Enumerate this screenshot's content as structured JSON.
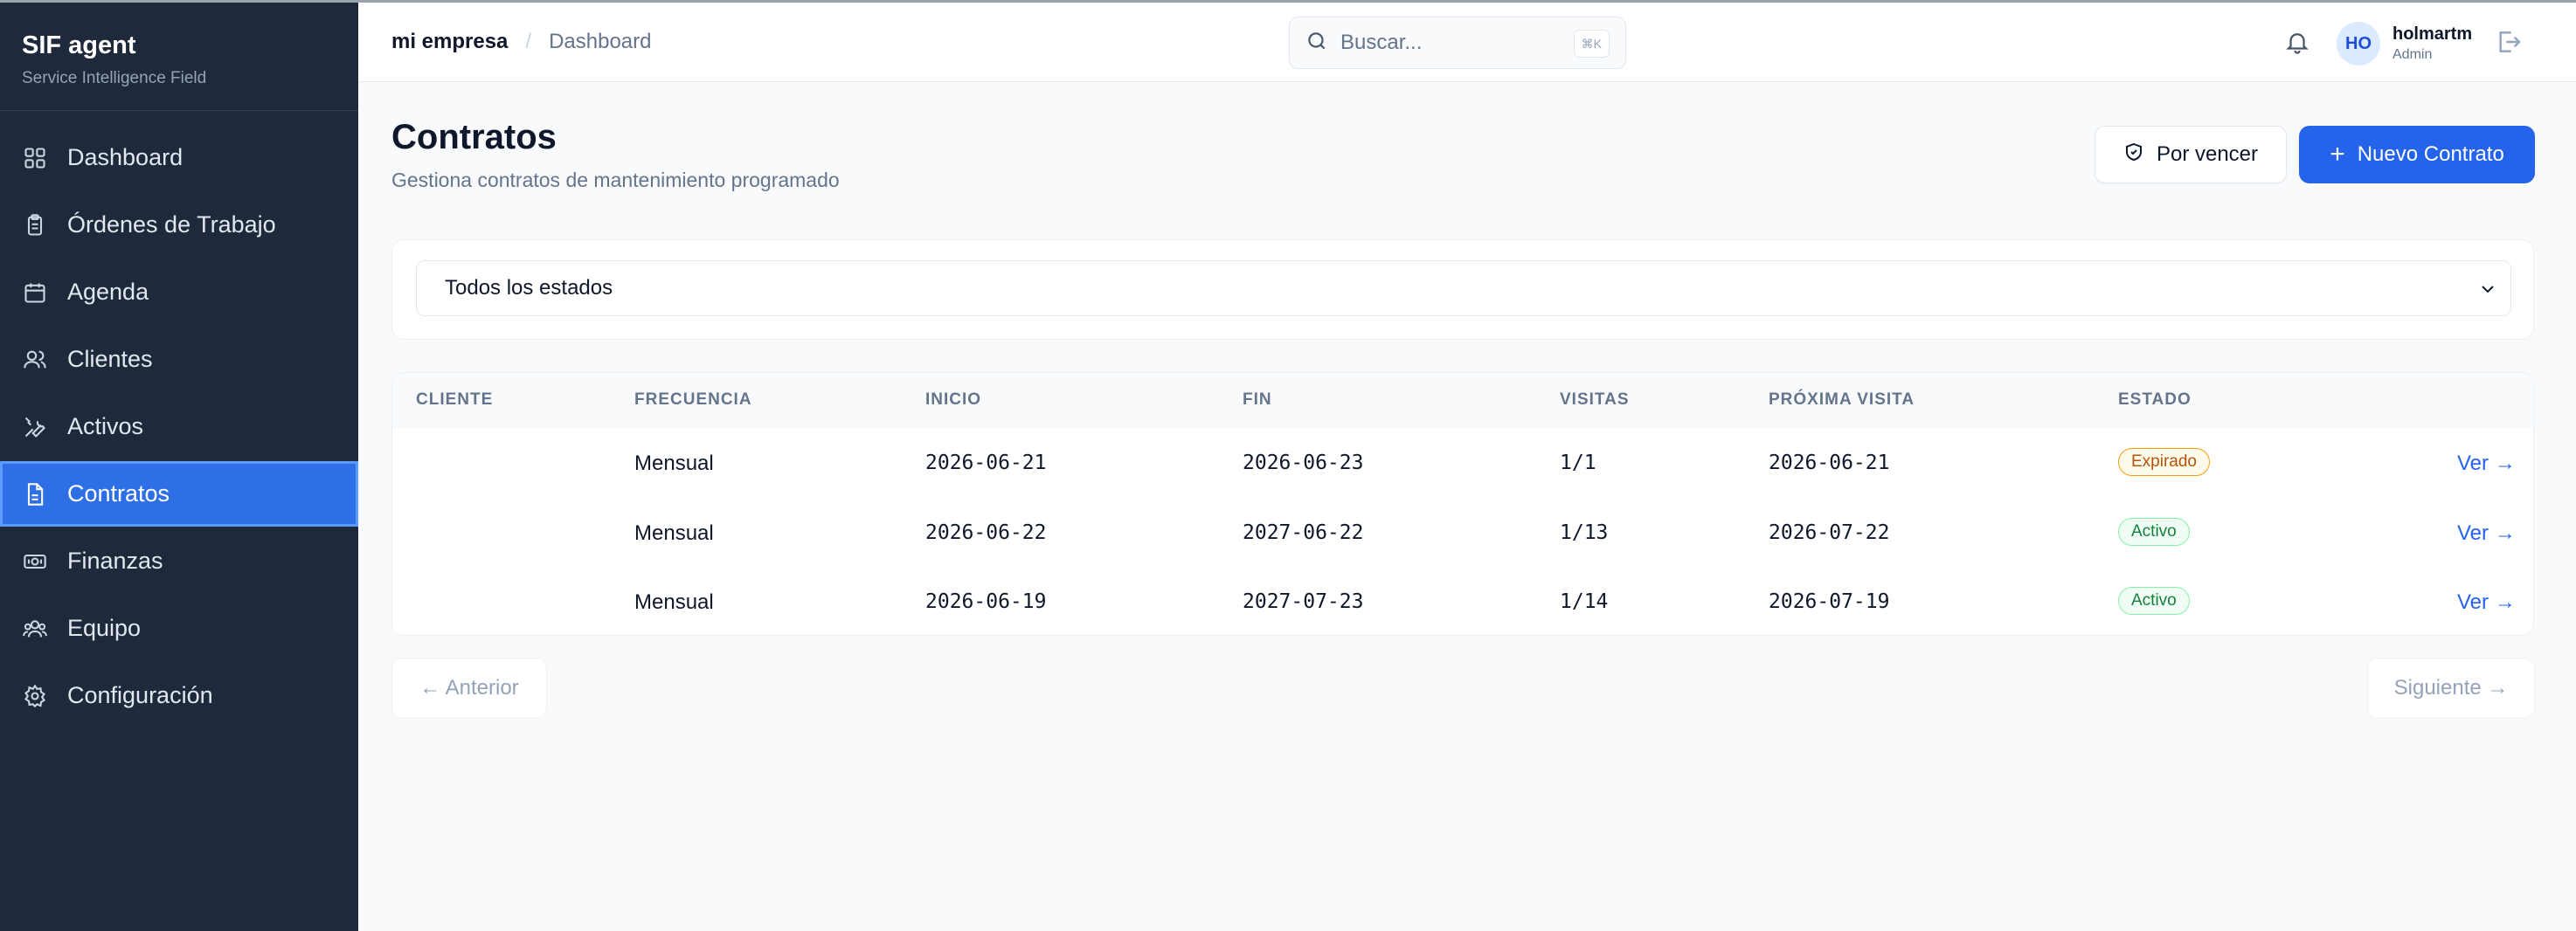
{
  "app": {
    "title": "SIF agent",
    "subtitle": "Service Intelligence Field"
  },
  "sidebar": {
    "items": [
      {
        "label": "Dashboard",
        "icon": "grid-icon",
        "active": false
      },
      {
        "label": "Órdenes de Trabajo",
        "icon": "clipboard-icon",
        "active": false
      },
      {
        "label": "Agenda",
        "icon": "calendar-icon",
        "active": false
      },
      {
        "label": "Clientes",
        "icon": "users-icon",
        "active": false
      },
      {
        "label": "Activos",
        "icon": "wrench-icon",
        "active": false
      },
      {
        "label": "Contratos",
        "icon": "file-text-icon",
        "active": true
      },
      {
        "label": "Finanzas",
        "icon": "banknote-icon",
        "active": false
      },
      {
        "label": "Equipo",
        "icon": "team-icon",
        "active": false
      },
      {
        "label": "Configuración",
        "icon": "gear-icon",
        "active": false
      }
    ]
  },
  "header": {
    "breadcrumb": {
      "root": "mi empresa",
      "separator": "/",
      "current": "Dashboard"
    },
    "search": {
      "placeholder": "Buscar...",
      "shortcut": "⌘K"
    },
    "user": {
      "initials": "HO",
      "name": "holmartm",
      "role": "Admin"
    }
  },
  "main": {
    "title": "Contratos",
    "subtitle": "Gestiona contratos de mantenimiento programado",
    "actions": {
      "expiring": "Por vencer",
      "new": "Nuevo Contrato"
    },
    "filter": {
      "selected": "Todos los estados"
    },
    "table": {
      "columns": [
        "CLIENTE",
        "FRECUENCIA",
        "INICIO",
        "FIN",
        "VISITAS",
        "PRÓXIMA VISITA",
        "ESTADO"
      ],
      "rows": [
        {
          "cliente": "",
          "frecuencia": "Mensual",
          "inicio": "2026-06-21",
          "fin": "2026-06-23",
          "visitas": "1/1",
          "proxima": "2026-06-21",
          "estado": "Expirado",
          "accion": "Ver →"
        },
        {
          "cliente": "",
          "frecuencia": "Mensual",
          "inicio": "2026-06-22",
          "fin": "2027-06-22",
          "visitas": "1/13",
          "proxima": "2026-07-22",
          "estado": "Activo",
          "accion": "Ver →"
        },
        {
          "cliente": "",
          "frecuencia": "Mensual",
          "inicio": "2026-06-19",
          "fin": "2027-07-23",
          "visitas": "1/14",
          "proxima": "2026-07-19",
          "estado": "Activo",
          "accion": "Ver →"
        }
      ]
    },
    "pagination": {
      "prev": "← Anterior",
      "next": "Siguiente →"
    }
  },
  "colors": {
    "sidebar_bg": "#1e293b",
    "accent": "#2563eb",
    "active_nav": "#2f6fe6"
  }
}
